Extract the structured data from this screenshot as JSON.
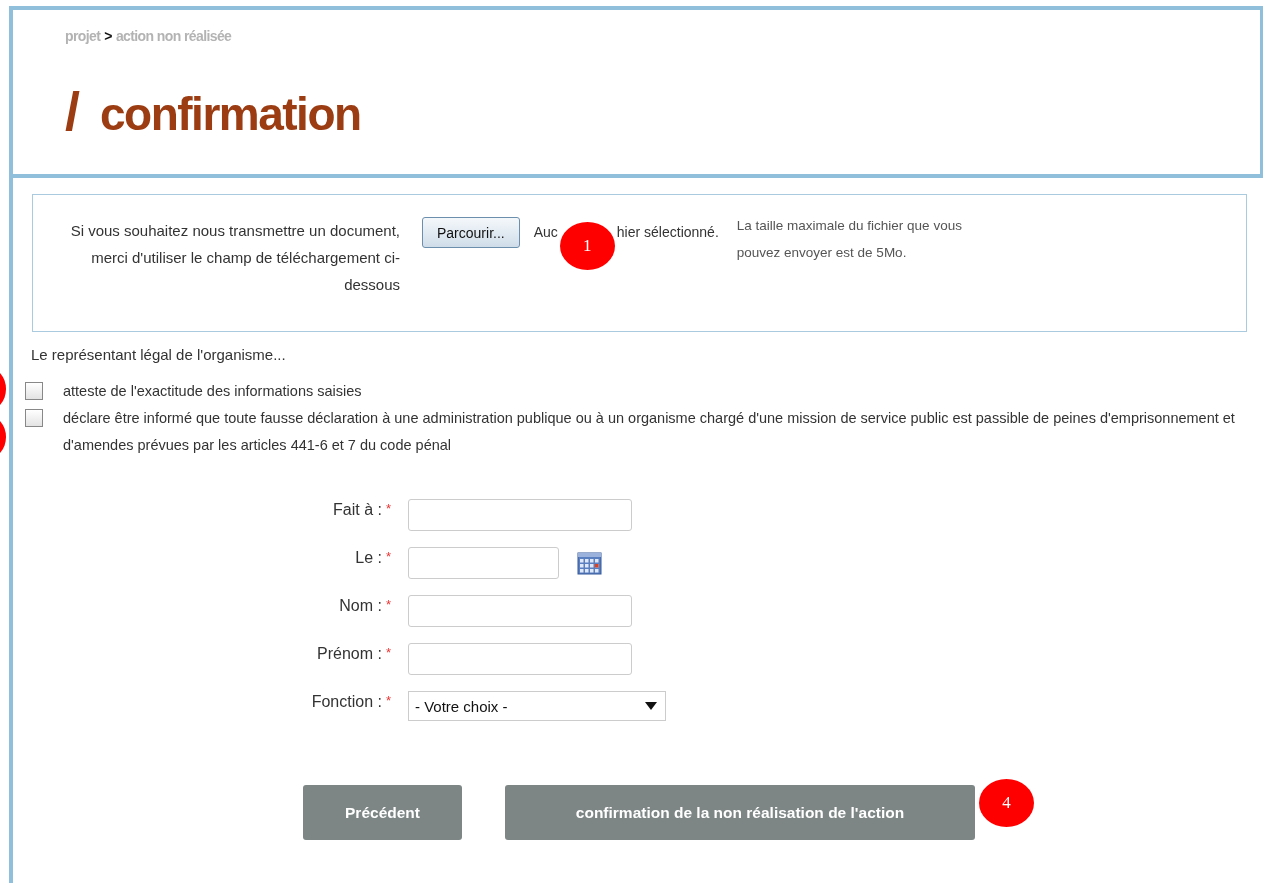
{
  "breadcrumb": {
    "parent": "projet",
    "separator": ">",
    "current": "action non réalisée"
  },
  "title": {
    "mark": "/",
    "text": "confirmation"
  },
  "upload": {
    "label": "Si vous souhaitez nous transmettre un document, merci d'utiliser le champ de téléchargement ci-dessous",
    "button": "Parcourir...",
    "status_parts": [
      "Auc",
      "hier sélectionné."
    ],
    "info": "La taille maximale du fichier que vous pouvez envoyer est de 5Mo."
  },
  "declaration": {
    "intro": "Le représentant légal de l'organisme...",
    "items": [
      {
        "text": "atteste de l'exactitude des informations saisies",
        "checked": false
      },
      {
        "text": "déclare être informé que toute fausse déclaration à une administration publique ou à un organisme chargé d'une mission de service public est passible de peines d'emprisonnement et d'amendes prévues par les articles 441-6 et 7 du code pénal",
        "checked": false
      }
    ]
  },
  "form": {
    "required_mark": "*",
    "fields": [
      {
        "label": "Fait à :",
        "kind": "text"
      },
      {
        "label": "Le :",
        "kind": "date"
      },
      {
        "label": "Nom :",
        "kind": "text"
      },
      {
        "label": "Prénom :",
        "kind": "text"
      },
      {
        "label": "Fonction :",
        "kind": "select",
        "value": "- Votre choix -"
      }
    ]
  },
  "buttons": [
    "Précédent",
    "confirmation de la non réalisation de l'action"
  ],
  "markers": [
    {
      "label": "1"
    },
    {
      "label": "4"
    }
  ],
  "side_markers": [
    {
      "kind": "cut"
    },
    {
      "kind": "cut"
    }
  ]
}
